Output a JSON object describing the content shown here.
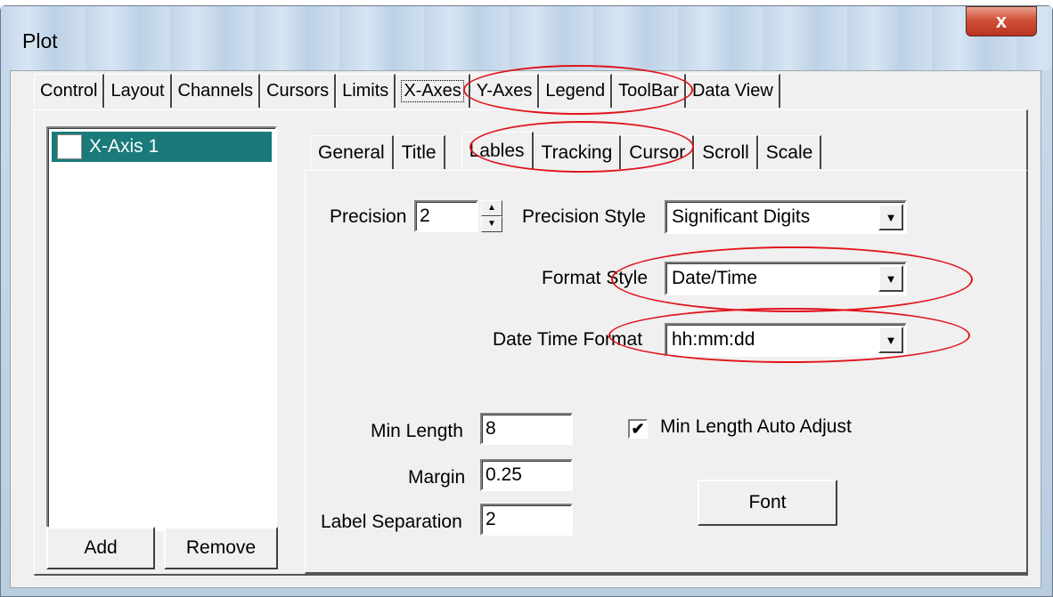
{
  "window": {
    "title": "Plot",
    "close_icon": "x-icon",
    "close_glyph": "x"
  },
  "tabs": [
    {
      "label": "Control"
    },
    {
      "label": "Layout"
    },
    {
      "label": "Channels"
    },
    {
      "label": "Cursors"
    },
    {
      "label": "Limits"
    },
    {
      "label": "X-Axes"
    },
    {
      "label": "Y-Axes"
    },
    {
      "label": "Legend"
    },
    {
      "label": "ToolBar"
    },
    {
      "label": "Data View"
    }
  ],
  "selected_tab": "X-Axes",
  "axis_list": {
    "items": [
      {
        "label": "X-Axis 1"
      }
    ]
  },
  "list_buttons": {
    "add": "Add",
    "remove": "Remove"
  },
  "subtabs": [
    {
      "label": "General"
    },
    {
      "label": "Title"
    },
    {
      "label": "Lables"
    },
    {
      "label": "Tracking"
    },
    {
      "label": "Cursor"
    },
    {
      "label": "Scroll"
    },
    {
      "label": "Scale"
    }
  ],
  "selected_subtab": "Lables",
  "form": {
    "precision_label": "Precision",
    "precision_value": "2",
    "precision_style_label": "Precision Style",
    "precision_style_value": "Significant Digits",
    "format_style_label": "Format Style",
    "format_style_value": "Date/Time",
    "date_time_format_label": "Date Time Format",
    "date_time_format_value": "hh:mm:dd",
    "min_length_label": "Min Length",
    "min_length_value": "8",
    "margin_label": "Margin",
    "margin_value": "0.25",
    "label_separation_label": "Label Separation",
    "label_separation_value": "2",
    "auto_adjust_label": "Min Length Auto Adjust",
    "auto_adjust_checked": true,
    "font_button": "Font"
  },
  "colors": {
    "highlight_ellipse": "#e0141c",
    "list_selection": "#1a7a7a"
  }
}
